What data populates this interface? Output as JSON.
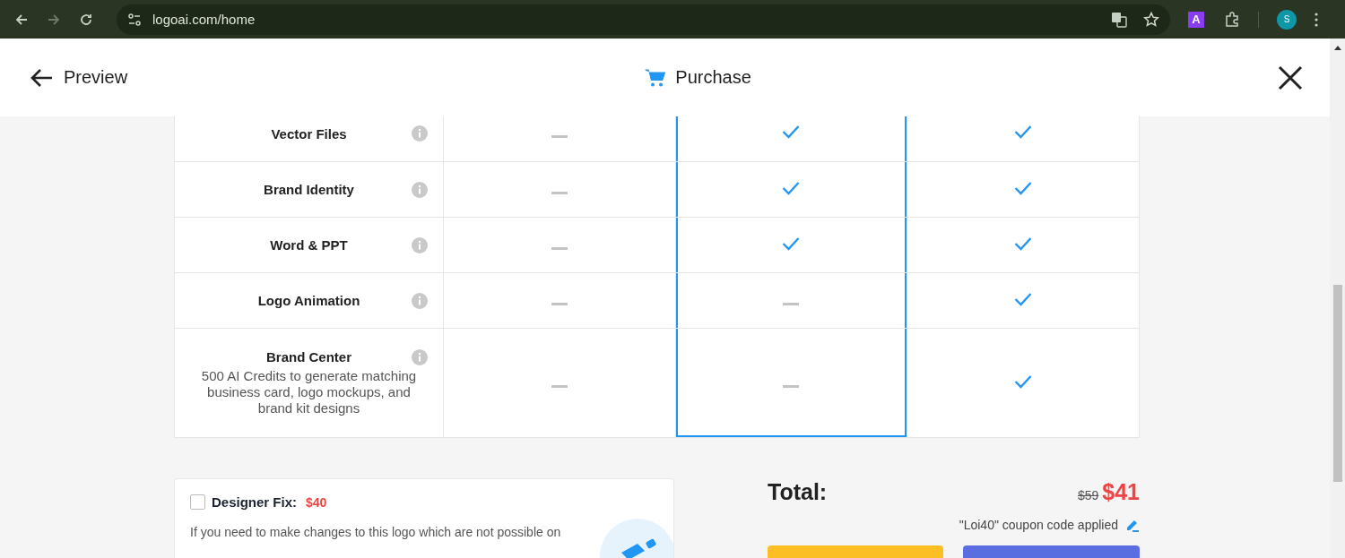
{
  "browser": {
    "url": "logoai.com/home",
    "profile_initial": "S",
    "extension_letter": "A"
  },
  "header": {
    "back_label": "Preview",
    "title": "Purchase"
  },
  "table": {
    "columns": [
      {
        "highlighted": false
      },
      {
        "highlighted": true
      },
      {
        "highlighted": false
      }
    ],
    "rows": [
      {
        "feature": "Vector Files",
        "cells": [
          {
            "included": false
          },
          {
            "included": true
          },
          {
            "included": true
          }
        ]
      },
      {
        "feature": "Brand Identity",
        "cells": [
          {
            "included": false
          },
          {
            "included": true
          },
          {
            "included": true
          }
        ]
      },
      {
        "feature": "Word & PPT",
        "cells": [
          {
            "included": false
          },
          {
            "included": true
          },
          {
            "included": true
          }
        ]
      },
      {
        "feature": "Logo Animation",
        "cells": [
          {
            "included": false
          },
          {
            "included": false
          },
          {
            "included": true
          }
        ]
      },
      {
        "feature": "Brand Center",
        "description": "500 AI Credits to generate matching business card, logo mockups, and brand kit designs",
        "cells": [
          {
            "included": false
          },
          {
            "included": false
          },
          {
            "included": true
          }
        ]
      }
    ]
  },
  "designer_fix": {
    "checked": false,
    "label": "Designer Fix:",
    "price": "$40",
    "description": "If you need to make changes to this logo which are not possible on"
  },
  "total": {
    "label": "Total:",
    "old_price": "$59",
    "price": "$41",
    "coupon_note": "\"Loi40\" coupon code applied"
  }
}
